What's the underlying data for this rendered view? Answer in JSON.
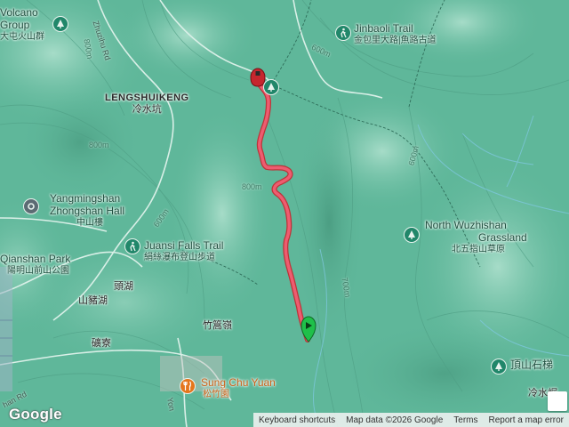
{
  "map": {
    "type": "terrain",
    "colors": {
      "terrain": "#5fb79a",
      "ridge": "#8fd1b9",
      "valley": "#3f8e74",
      "contour": "#4f9f85",
      "road": "#d9efe7",
      "track": "#ee5c70",
      "start": "#1fc04a",
      "end": "#c6262e"
    }
  },
  "places": [
    {
      "id": "volcano-group",
      "en": "Volcano",
      "en2": "Group",
      "zh": "大屯火山群",
      "icon": "park-icon"
    },
    {
      "id": "jinbaoli-trail",
      "en": "Jinbaoli Trail",
      "zh": "金包里大路|魚路古道",
      "icon": "hiker-icon"
    },
    {
      "id": "lengshuikeng",
      "en": "LENGSHUIKENG",
      "zh": "冷水坑"
    },
    {
      "id": "yangmingshan-hall",
      "en": "Yangmingshan",
      "en2": "Zhongshan Hall",
      "zh": "中山樓",
      "icon": "landmark-icon"
    },
    {
      "id": "north-wuzhishan",
      "en": "North Wuzhishan",
      "en2": "Grassland",
      "zh": "北五指山草原",
      "icon": "park-icon"
    },
    {
      "id": "qianshan-park",
      "en": "Qianshan Park",
      "zh": "陽明山前山公園",
      "icon": "park-icon"
    },
    {
      "id": "juansi-falls",
      "en": "Juansi Falls Trail",
      "zh": "絹絲瀑布登山步道",
      "icon": "hiker-icon"
    },
    {
      "id": "toutou",
      "zh": "頭湖"
    },
    {
      "id": "shanzhuhu",
      "zh": "山豬湖"
    },
    {
      "id": "zhuzihling",
      "zh": "竹篙嶺"
    },
    {
      "id": "kuangliao",
      "zh": "礦寮"
    },
    {
      "id": "sung-chu-yuan",
      "en": "Sung Chu Yuan",
      "zh": "松竹園",
      "icon": "restaurant-icon"
    },
    {
      "id": "dingshan",
      "zh": "頂山石梯",
      "icon": "park-icon"
    },
    {
      "id": "lengshuikeng-se",
      "zh": "冷水崛"
    }
  ],
  "roads": [
    {
      "id": "zhuzihu-rd",
      "label": "Zhuzihu Rd"
    },
    {
      "id": "yangjin-rd",
      "label": "han Rd"
    },
    {
      "id": "yon-rd",
      "label": "Yon"
    }
  ],
  "contour_labels": [
    "800m",
    "800m",
    "600m",
    "600m",
    "600m",
    "800m",
    "700m"
  ],
  "track": {
    "start_marker": "start-pin",
    "end_marker": "end-pin"
  },
  "footer": {
    "keyboard_shortcuts": "Keyboard shortcuts",
    "map_data": "Map data ©2026 Google",
    "terms": "Terms",
    "report": "Report a map error",
    "logo": "Google"
  }
}
